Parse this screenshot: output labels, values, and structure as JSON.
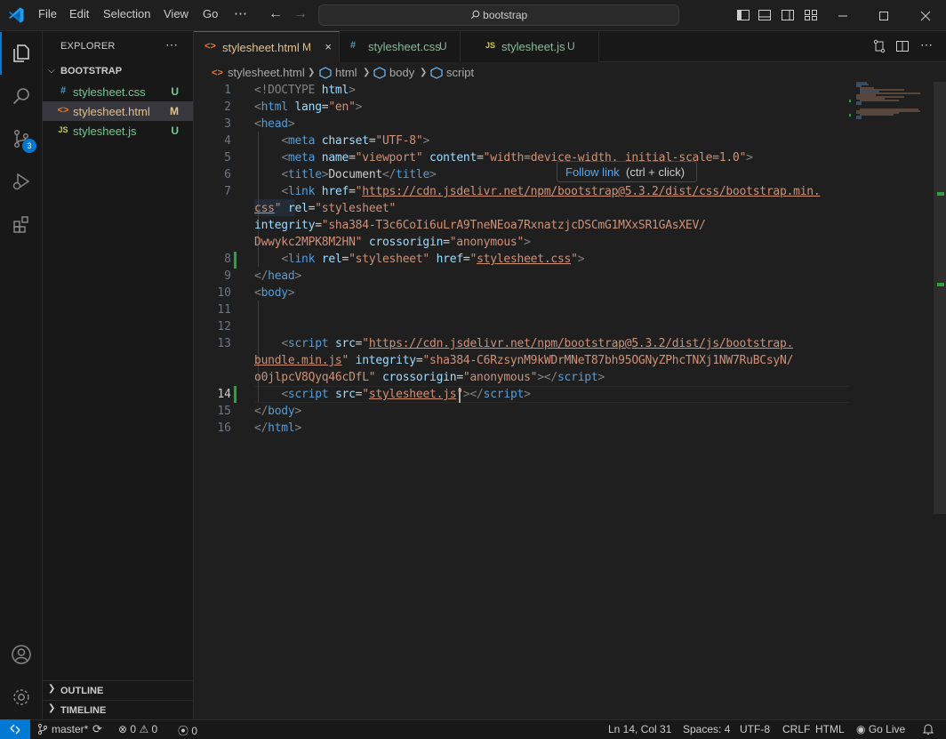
{
  "titlebar": {
    "menu": [
      "File",
      "Edit",
      "Selection",
      "View",
      "Go"
    ],
    "more_label": "⋯",
    "search_text": "bootstrap"
  },
  "activity": {
    "scm_badge": "3"
  },
  "explorer": {
    "title": "EXPLORER",
    "folder": "BOOTSTRAP",
    "files": [
      {
        "icon": "#",
        "name": "stylesheet.css",
        "badge": "U"
      },
      {
        "icon": "<>",
        "name": "stylesheet.html",
        "badge": "M"
      },
      {
        "icon": "JS",
        "name": "stylesheet.js",
        "badge": "U"
      }
    ],
    "outline": "OUTLINE",
    "timeline": "TIMELINE"
  },
  "tabs": [
    {
      "icon": "<>",
      "label": "stylesheet.html",
      "badge": "M",
      "close": "×"
    },
    {
      "icon": "#",
      "label": "stylesheet.css",
      "badge": "U"
    },
    {
      "icon": "JS",
      "label": "stylesheet.js",
      "badge": "U"
    }
  ],
  "breadcrumb": [
    "stylesheet.html",
    "html",
    "body",
    "script"
  ],
  "editor": {
    "line_numbers": [
      "1",
      "2",
      "3",
      "4",
      "5",
      "6",
      "7",
      "",
      "",
      "8",
      "9",
      "10",
      "11",
      "12",
      "13",
      "",
      "",
      "14",
      "15",
      "16"
    ],
    "current_line": "14"
  },
  "hover": {
    "link": "Follow link",
    "keys": "(ctrl + click)"
  },
  "status": {
    "branch": "master*",
    "errors": "0",
    "warnings": "0",
    "ports": "0",
    "position": "Ln 14, Col 31",
    "spaces": "Spaces: 4",
    "encoding": "UTF-8",
    "eol": "CRLF",
    "language": "HTML",
    "golive": "Go Live"
  },
  "colors": {
    "accent": "#0078d4",
    "modified_gutter": "#2ea043"
  }
}
